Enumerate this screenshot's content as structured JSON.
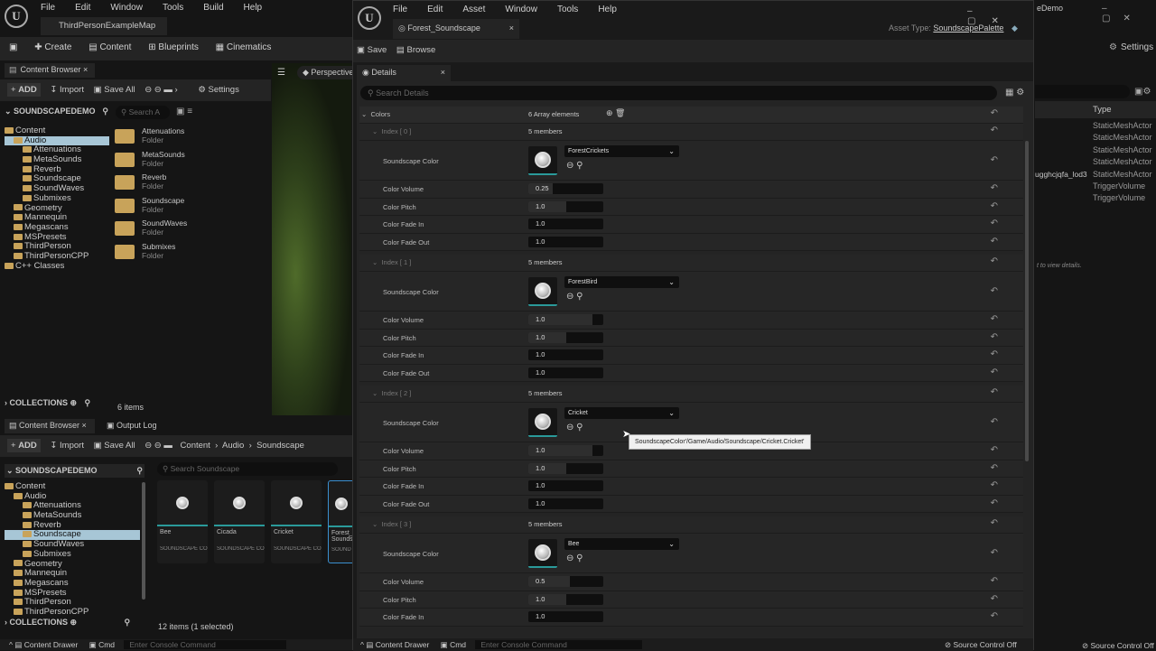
{
  "main": {
    "menu": [
      "File",
      "Edit",
      "Window",
      "Tools",
      "Build",
      "Help"
    ],
    "map_tab": "ThirdPersonExampleMap",
    "toolbar": [
      "Create",
      "Content",
      "Blueprints",
      "Cinematics"
    ],
    "settings": "Settings",
    "cb_tab": "Content Browser",
    "add": "ADD",
    "import": "Import",
    "save_all": "Save All",
    "cb_settings": "Settings",
    "project": "SOUNDSCAPEDEMO",
    "search_placeholder": "Search A",
    "tree": [
      {
        "l": "Content",
        "d": 0
      },
      {
        "l": "Audio",
        "d": 1,
        "sel": true
      },
      {
        "l": "Attenuations",
        "d": 2
      },
      {
        "l": "MetaSounds",
        "d": 2
      },
      {
        "l": "Reverb",
        "d": 2
      },
      {
        "l": "Soundscape",
        "d": 2
      },
      {
        "l": "SoundWaves",
        "d": 2
      },
      {
        "l": "Submixes",
        "d": 2
      },
      {
        "l": "Geometry",
        "d": 1
      },
      {
        "l": "Mannequin",
        "d": 1
      },
      {
        "l": "Megascans",
        "d": 1
      },
      {
        "l": "MSPresets",
        "d": 1
      },
      {
        "l": "ThirdPerson",
        "d": 1
      },
      {
        "l": "ThirdPersonCPP",
        "d": 1
      },
      {
        "l": "C++ Classes",
        "d": 0
      }
    ],
    "folders": [
      {
        "n": "Attenuations",
        "t": "Folder"
      },
      {
        "n": "MetaSounds",
        "t": "Folder"
      },
      {
        "n": "Reverb",
        "t": "Folder"
      },
      {
        "n": "Soundscape",
        "t": "Folder"
      },
      {
        "n": "SoundWaves",
        "t": "Folder"
      },
      {
        "n": "Submixes",
        "t": "Folder"
      }
    ],
    "collections": "COLLECTIONS",
    "items_count": "6 items",
    "viewport": "Perspective",
    "cb2_tab": "Content Browser",
    "output_log": "Output Log",
    "breadcrumb": [
      "Content",
      "Audio",
      "Soundscape"
    ],
    "search2_placeholder": "Search Soundscape",
    "tree2": [
      {
        "l": "Content",
        "d": 0
      },
      {
        "l": "Audio",
        "d": 1
      },
      {
        "l": "Attenuations",
        "d": 2
      },
      {
        "l": "MetaSounds",
        "d": 2
      },
      {
        "l": "Reverb",
        "d": 2
      },
      {
        "l": "Soundscape",
        "d": 2,
        "sel": true
      },
      {
        "l": "SoundWaves",
        "d": 2
      },
      {
        "l": "Submixes",
        "d": 2
      },
      {
        "l": "Geometry",
        "d": 1
      },
      {
        "l": "Mannequin",
        "d": 1
      },
      {
        "l": "Megascans",
        "d": 1
      },
      {
        "l": "MSPresets",
        "d": 1
      },
      {
        "l": "ThirdPerson",
        "d": 1
      },
      {
        "l": "ThirdPersonCPP",
        "d": 1
      }
    ],
    "tiles": [
      {
        "n": "Bee",
        "t": "SOUNDSCAPE CO"
      },
      {
        "n": "Cicada",
        "t": "SOUNDSCAPE CO"
      },
      {
        "n": "Cricket",
        "t": "SOUNDSCAPE CO"
      },
      {
        "n": "Forest_ Sounds",
        "t": "SOUND"
      }
    ],
    "items2_count": "12 items (1 selected)",
    "content_drawer": "Content Drawer",
    "cmd": "Cmd",
    "console_placeholder": "Enter Console Command",
    "title_right": "eDemo",
    "type_header": "Type",
    "types": [
      "StaticMeshActor",
      "StaticMeshActor",
      "StaticMeshActor",
      "StaticMeshActor",
      "StaticMeshActor",
      "TriggerVolume",
      "TriggerVolume"
    ],
    "partial_name": "ugghcjqfa_lod3",
    "hint": "t to view details.",
    "source_control": "Source Control Off"
  },
  "editor": {
    "menu": [
      "File",
      "Edit",
      "Asset",
      "Window",
      "Tools",
      "Help"
    ],
    "tab": "Forest_Soundscape",
    "asset_type_label": "Asset Type:",
    "asset_type": "SoundscapePalette",
    "save": "Save",
    "browse": "Browse",
    "details_tab": "Details",
    "search_placeholder": "Search Details",
    "colors_label": "Colors",
    "colors_count": "6 Array elements",
    "indices": [
      {
        "label": "Index [ 0 ]",
        "members": "5 members",
        "color": "ForestCrickets",
        "volume": "0.25",
        "pitch": "1.0",
        "fade_in": "1.0",
        "fade_out": "1.0",
        "volume_fill": 0.33,
        "pitch_fill": 0.5
      },
      {
        "label": "Index [ 1 ]",
        "members": "5 members",
        "color": "ForestBird",
        "volume": "1.0",
        "pitch": "1.0",
        "fade_in": "1.0",
        "fade_out": "1.0",
        "volume_fill": 0.85,
        "pitch_fill": 0.5
      },
      {
        "label": "Index [ 2 ]",
        "members": "5 members",
        "color": "Cricket",
        "volume": "1.0",
        "pitch": "1.0",
        "fade_in": "1.0",
        "fade_out": "1.0",
        "volume_fill": 0.85,
        "pitch_fill": 0.5
      },
      {
        "label": "Index [ 3 ]",
        "members": "5 members",
        "color": "Bee",
        "volume": "0.5",
        "pitch": "1.0",
        "fade_in": "1.0",
        "volume_fill": 0.55,
        "pitch_fill": 0.5
      }
    ],
    "field_labels": {
      "color": "Soundscape Color",
      "volume": "Color Volume",
      "pitch": "Color Pitch",
      "fade_in": "Color Fade In",
      "fade_out": "Color Fade Out"
    },
    "tooltip": "SoundscapeColor'/Game/Audio/Soundscape/Cricket.Cricket'",
    "content_drawer": "Content Drawer",
    "cmd": "Cmd",
    "console_placeholder": "Enter Console Command",
    "source_control": "Source Control Off"
  }
}
